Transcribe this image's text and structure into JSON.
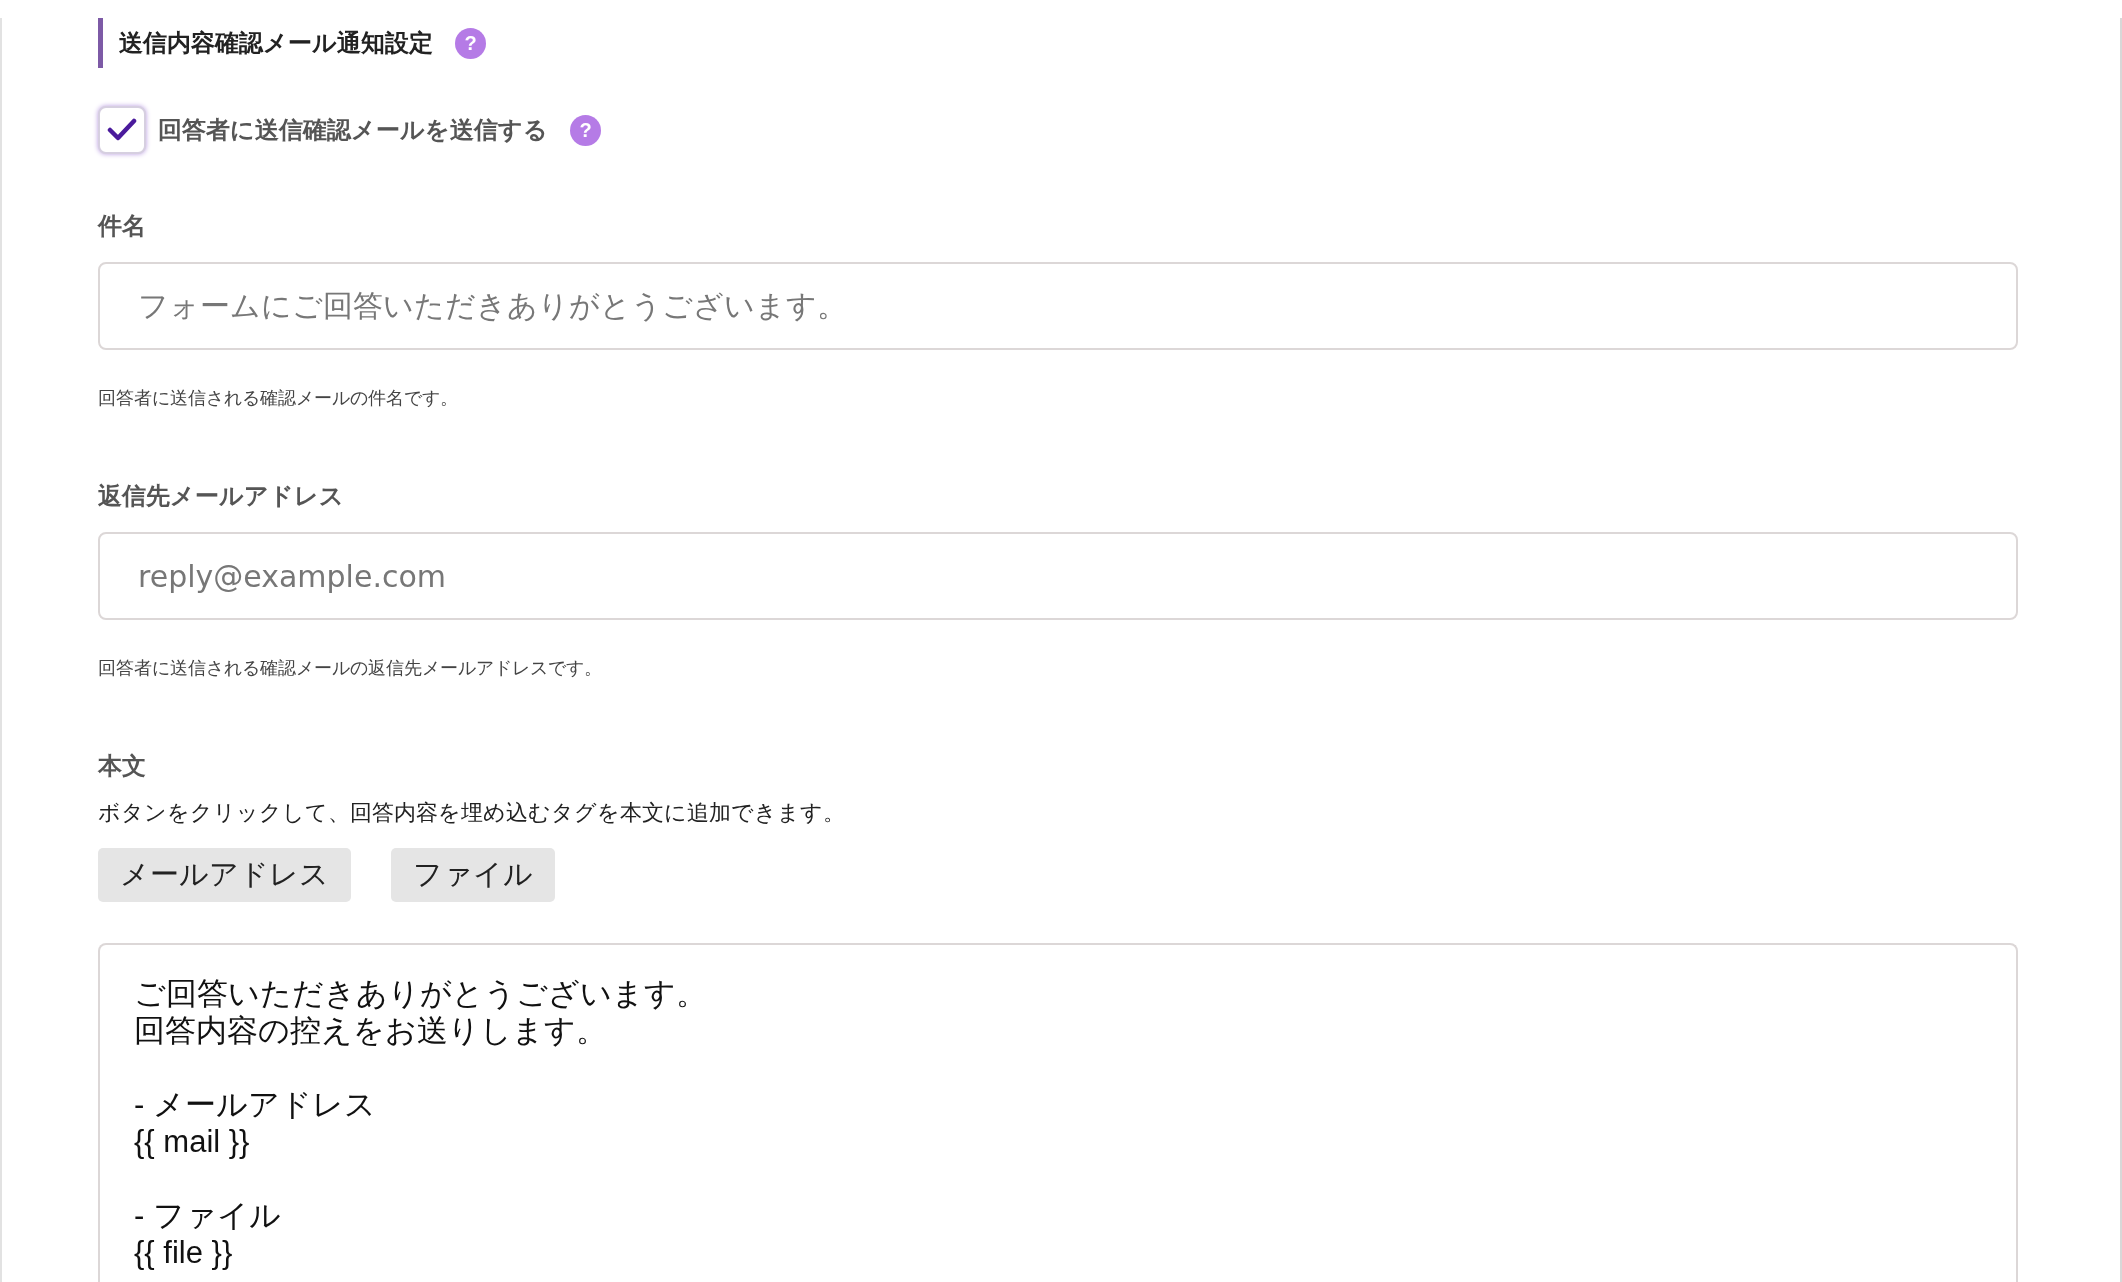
{
  "section": {
    "title": "送信内容確認メール通知設定",
    "help": "?"
  },
  "send_confirmation": {
    "label": "回答者に送信確認メールを送信する",
    "checked": true,
    "help": "?"
  },
  "fields": [
    {
      "label": "件名",
      "placeholder": "フォームにご回答いただきありがとうございます。",
      "hint": "回答者に送信される確認メールの件名です。"
    },
    {
      "label": "返信先メールアドレス",
      "placeholder": "reply@example.com",
      "hint": "回答者に送信される確認メールの返信先メールアドレスです。"
    }
  ],
  "body": {
    "label": "本文",
    "description": "ボタンをクリックして、回答内容を埋め込むタグを本文に追加できます。",
    "tag_buttons": [
      "メールアドレス",
      "ファイル"
    ],
    "paragraphs": [
      [
        "ご回答いただきありがとうございます。",
        "回答内容の控えをお送りします。"
      ],
      [
        "- メールアドレス",
        "{{ mail }}"
      ],
      [
        "- ファイル",
        "{{ file }}"
      ]
    ]
  }
}
